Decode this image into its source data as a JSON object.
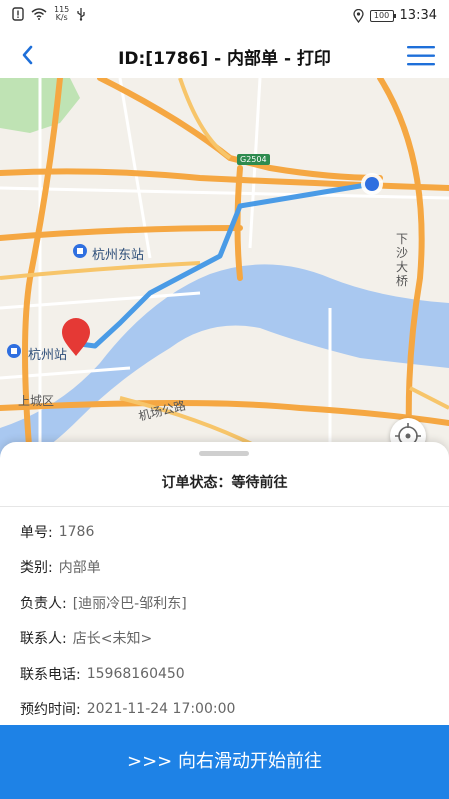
{
  "status_bar": {
    "speed_value": "115",
    "speed_unit": "K/s",
    "battery": "100",
    "time": "13:34"
  },
  "nav": {
    "title": "ID:[1786] - 内部单 - 打印"
  },
  "map": {
    "labels": {
      "hangzhou_east": "杭州东站",
      "hangzhou": "杭州站",
      "shangcheng": "上城区",
      "jichang_road": "机场公路",
      "xiasha_bridge": "下沙大桥",
      "g2504": "G2504"
    },
    "colors": {
      "route": "#4a9be6",
      "major_road": "#f5a742",
      "water": "#a9c8f0",
      "start_marker": "#e53935",
      "end_marker": "#2f6fe0"
    }
  },
  "sheet": {
    "order_status": "订单状态：等待前往",
    "rows": [
      {
        "label": "单号:",
        "value": "1786"
      },
      {
        "label": "类别:",
        "value": "内部单"
      },
      {
        "label": "负责人:",
        "value": "[迪丽冷巴-邹利东]"
      },
      {
        "label": "联系人:",
        "value": "店长<未知>"
      },
      {
        "label": "联系电话:",
        "value": "15968160450"
      },
      {
        "label": "预约时间:",
        "value": "2021-11-24 17:00:00"
      }
    ]
  },
  "swipe_bar": {
    "label": ">>> 向右滑动开始前往"
  }
}
